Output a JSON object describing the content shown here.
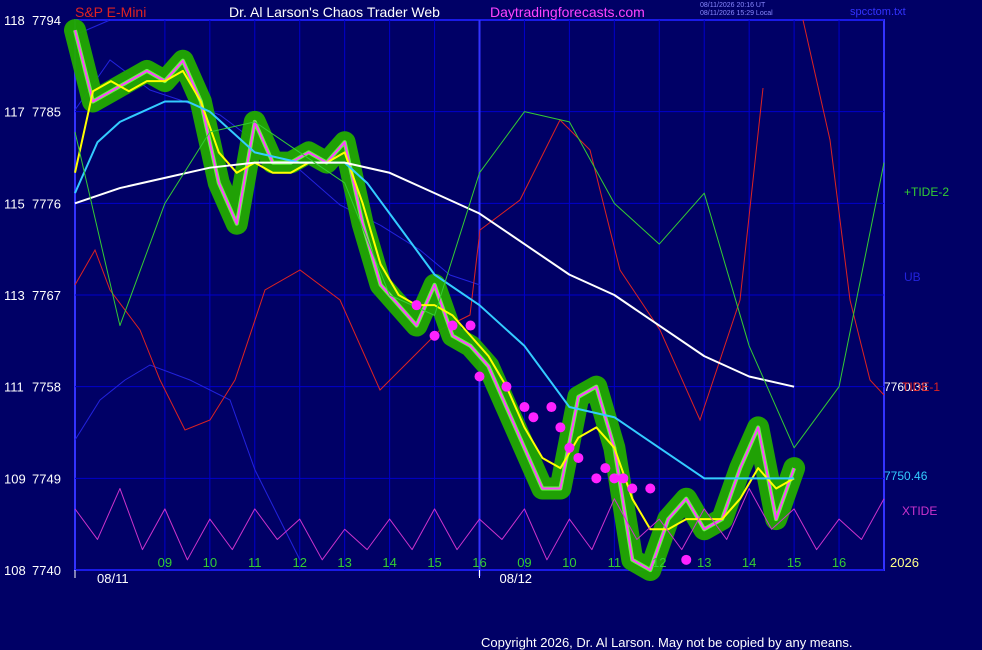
{
  "header": {
    "symbol": "S&P E-Mini",
    "site": "Dr. Al Larson's Chaos Trader Web",
    "url": "Daytradingforecasts.com",
    "stamp_utc": "08/11/2026 20:16 UT",
    "stamp_local": "08/11/2026 15:29 Local",
    "filename": "spcctom.txt"
  },
  "copyright": "Copyright 2026, Dr. Al Larson. May not be copied by any means.",
  "colors": {
    "background": "#000066",
    "grid": "#0000cc",
    "frame": "#3333ff",
    "price_halo": "#22aa00",
    "price_line": "#ff44ff",
    "fast_avg": "#ffff00",
    "mid_avg": "#33ccff",
    "slow_avg": "#ffffff",
    "tide2": "#33cc33",
    "xtide": "#cc33cc",
    "ub_lb": "#2222dd",
    "red_tide": "#dd2222",
    "buy_dots": "#ff22ff"
  },
  "chart_data": {
    "type": "line",
    "title": "S&P E-Mini",
    "y_axis_labels": [
      {
        "left": "118",
        "right": "7794"
      },
      {
        "left": "117",
        "right": "7785"
      },
      {
        "left": "115",
        "right": "7776"
      },
      {
        "left": "113",
        "right": "7767"
      },
      {
        "left": "111",
        "right": "7758"
      },
      {
        "left": "109",
        "right": "7749"
      },
      {
        "left": "108",
        "right": "7740"
      }
    ],
    "ylim": [
      7740,
      7794
    ],
    "xlim": [
      8,
      17
    ],
    "hour_labels": [
      "09",
      "10",
      "11",
      "12",
      "13",
      "14",
      "15",
      "16",
      "09",
      "10",
      "11",
      "12",
      "13",
      "14",
      "15",
      "16"
    ],
    "date_labels": [
      "08/11",
      "08/12"
    ],
    "year_label": "2026",
    "right_labels": [
      {
        "text": "+TIDE-2",
        "color": "#33cc33"
      },
      {
        "text": "UB",
        "color": "#2222dd"
      },
      {
        "text": "7760.33",
        "color": "#ffffff"
      },
      {
        "text": "TIDE-1",
        "color": "#dd2222"
      },
      {
        "text": "7750.46",
        "color": "#33ccff"
      },
      {
        "text": "XTIDE",
        "color": "#cc33cc"
      }
    ],
    "series": [
      {
        "name": "price",
        "x": [
          8,
          8.2,
          8.4,
          8.6,
          8.8,
          9,
          9.2,
          9.4,
          9.6,
          9.8,
          10,
          10.2,
          10.4,
          10.6,
          10.8,
          11,
          11.2,
          11.4,
          11.6,
          11.8,
          12,
          12.2,
          12.4,
          12.6,
          12.8,
          13,
          13.2,
          13.4,
          13.6,
          13.8,
          14,
          14.2,
          14.4,
          14.6,
          14.8,
          15,
          15.2,
          15.4,
          15.6,
          15.8,
          16
        ],
        "y": [
          7793,
          7786,
          7787,
          7788,
          7789,
          7788,
          7790,
          7786,
          7778,
          7774,
          7784,
          7780,
          7780,
          7781,
          7780,
          7782,
          7774,
          7768,
          7766,
          7764,
          7768,
          7763,
          7762,
          7760,
          7756,
          7752,
          7748,
          7748,
          7757,
          7758,
          7752,
          7741,
          7740,
          7745,
          7747,
          7744,
          7745,
          7750,
          7754,
          7745,
          7750
        ]
      },
      {
        "name": "fast_avg",
        "x": [
          8,
          8.2,
          8.4,
          8.6,
          8.8,
          9,
          9.2,
          9.4,
          9.6,
          9.8,
          10,
          10.2,
          10.4,
          10.6,
          10.8,
          11,
          11.2,
          11.4,
          11.6,
          11.8,
          12,
          12.2,
          12.4,
          12.6,
          12.8,
          13,
          13.2,
          13.4,
          13.6,
          13.8,
          14,
          14.2,
          14.4,
          14.6,
          14.8,
          15,
          15.2,
          15.4,
          15.6,
          15.8,
          16
        ],
        "y": [
          7779,
          7787,
          7788,
          7787,
          7788,
          7788,
          7789,
          7786,
          7781,
          7779,
          7780,
          7779,
          7779,
          7780,
          7780,
          7781,
          7776,
          7770,
          7767,
          7766,
          7766,
          7765,
          7763,
          7761,
          7758,
          7754,
          7751,
          7750,
          7753,
          7754,
          7752,
          7747,
          7744,
          7744,
          7745,
          7745,
          7745,
          7747,
          7750,
          7748,
          7749
        ]
      },
      {
        "name": "mid_avg",
        "x": [
          8,
          8.25,
          8.5,
          8.75,
          9,
          9.25,
          9.5,
          9.75,
          10,
          10.5,
          11,
          11.25,
          11.5,
          12,
          12.5,
          13,
          13.5,
          14,
          14.5,
          15,
          15.5,
          16
        ],
        "y": [
          7777,
          7782,
          7784,
          7785,
          7786,
          7786,
          7785,
          7783,
          7781,
          7780,
          7780,
          7778,
          7775,
          7769,
          7766,
          7762,
          7756,
          7755,
          7752,
          7749,
          7749,
          7749
        ]
      },
      {
        "name": "slow_avg",
        "x": [
          8,
          8.5,
          9,
          9.5,
          10,
          10.5,
          11,
          11.5,
          12,
          12.5,
          13,
          13.5,
          14,
          14.5,
          15,
          15.5,
          16
        ],
        "y": [
          7776,
          7777.5,
          7778.5,
          7779.5,
          7780,
          7780,
          7780,
          7779,
          7777,
          7775,
          7772,
          7769,
          7767,
          7764,
          7761,
          7759,
          7758
        ]
      },
      {
        "name": "+TIDE-2",
        "x": [
          8,
          8.5,
          9,
          9.5,
          10,
          10.5,
          11,
          11.5,
          12,
          12.5,
          13,
          13.5,
          14,
          14.5,
          15,
          15.5,
          16,
          16.5,
          17
        ],
        "y": [
          7783,
          7764,
          7776,
          7783,
          7784,
          7781,
          7778,
          7767,
          7765,
          7779,
          7785,
          7784,
          7776,
          7772,
          7777,
          7762,
          7752,
          7758,
          7780
        ]
      },
      {
        "name": "XTIDE",
        "x": [
          8,
          8.25,
          8.5,
          8.75,
          9,
          9.25,
          9.5,
          9.75,
          10,
          10.25,
          10.5,
          10.75,
          11,
          11.25,
          11.5,
          11.75,
          12,
          12.25,
          12.5,
          12.75,
          13,
          13.25,
          13.5,
          13.75,
          14,
          14.25,
          14.5,
          14.75,
          15,
          15.25,
          15.5,
          15.75,
          16,
          16.25,
          16.5,
          16.75,
          17
        ],
        "y": [
          7746,
          7743,
          7748,
          7742,
          7746,
          7741,
          7745,
          7742,
          7746,
          7743,
          7745,
          7741,
          7744,
          7742,
          7745,
          7742,
          7746,
          7742,
          7745,
          7743,
          7746,
          7741,
          7745,
          7742,
          7747,
          7743,
          7745,
          7742,
          7746,
          7743,
          7748,
          7744,
          7746,
          7742,
          7745,
          7743,
          7747
        ]
      }
    ],
    "buy_dots": {
      "x": [
        11.8,
        12.0,
        12.2,
        12.4,
        12.5,
        12.8,
        13.0,
        13.1,
        13.3,
        13.4,
        13.5,
        13.6,
        13.8,
        13.9,
        14.0,
        14.1,
        14.2,
        14.4,
        14.8
      ],
      "y": [
        7766,
        7763,
        7764,
        7764,
        7759,
        7758,
        7756,
        7755,
        7756,
        7754,
        7752,
        7751,
        7749,
        7750,
        7749,
        7749,
        7748,
        7748,
        7741
      ]
    }
  }
}
